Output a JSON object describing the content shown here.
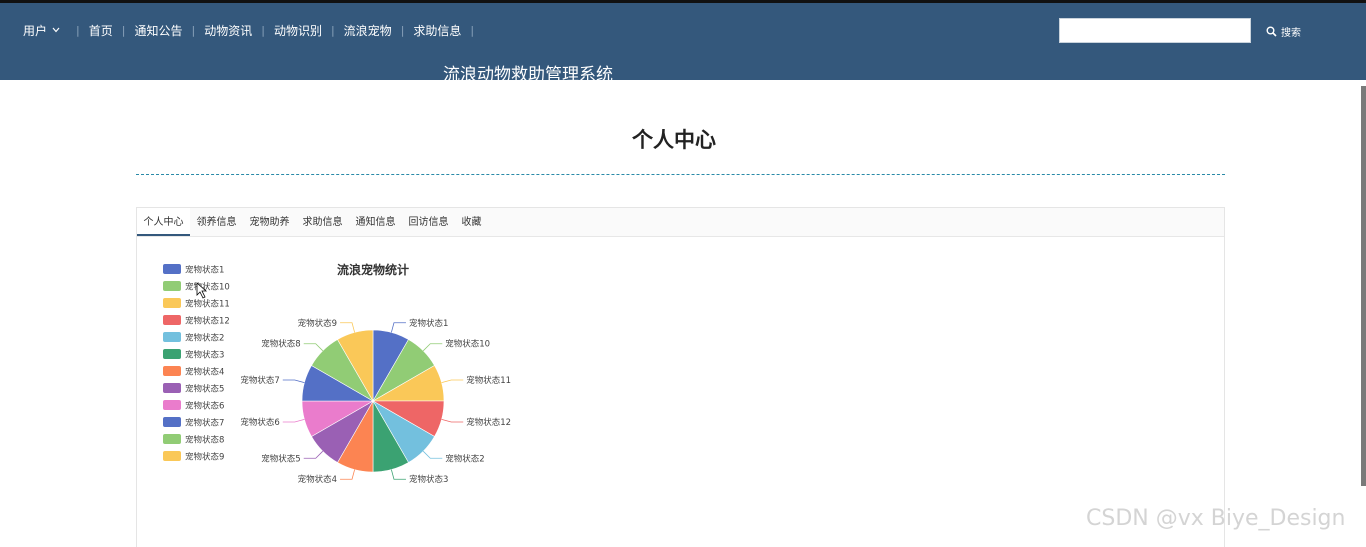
{
  "header": {
    "user_label": "用户",
    "nav": [
      "首页",
      "通知公告",
      "动物资讯",
      "动物识别",
      "流浪宠物",
      "求助信息"
    ],
    "search_label": "搜索",
    "site_title": "流浪动物救助管理系统"
  },
  "page": {
    "title": "个人中心"
  },
  "tabs": [
    "个人中心",
    "领养信息",
    "宠物助养",
    "求助信息",
    "通知信息",
    "回访信息",
    "收藏"
  ],
  "watermark": "CSDN @vx Biye_Design",
  "colors": {
    "header_bg": "#34587c",
    "divider": "#2a8aa8"
  },
  "chart_data": {
    "type": "pie",
    "title": "流浪宠物统计",
    "categories": [
      "宠物状态1",
      "宠物状态10",
      "宠物状态11",
      "宠物状态12",
      "宠物状态2",
      "宠物状态3",
      "宠物状态4",
      "宠物状态5",
      "宠物状态6",
      "宠物状态7",
      "宠物状态8",
      "宠物状态9"
    ],
    "values": [
      1,
      1,
      1,
      1,
      1,
      1,
      1,
      1,
      1,
      1,
      1,
      1
    ],
    "colors": [
      "#5470c6",
      "#91cc75",
      "#fac858",
      "#ee6666",
      "#73c0de",
      "#3ba272",
      "#fc8452",
      "#9a60b4",
      "#ea7ccc",
      "#5470c6",
      "#91cc75",
      "#fac858"
    ],
    "legend_position": "left"
  }
}
